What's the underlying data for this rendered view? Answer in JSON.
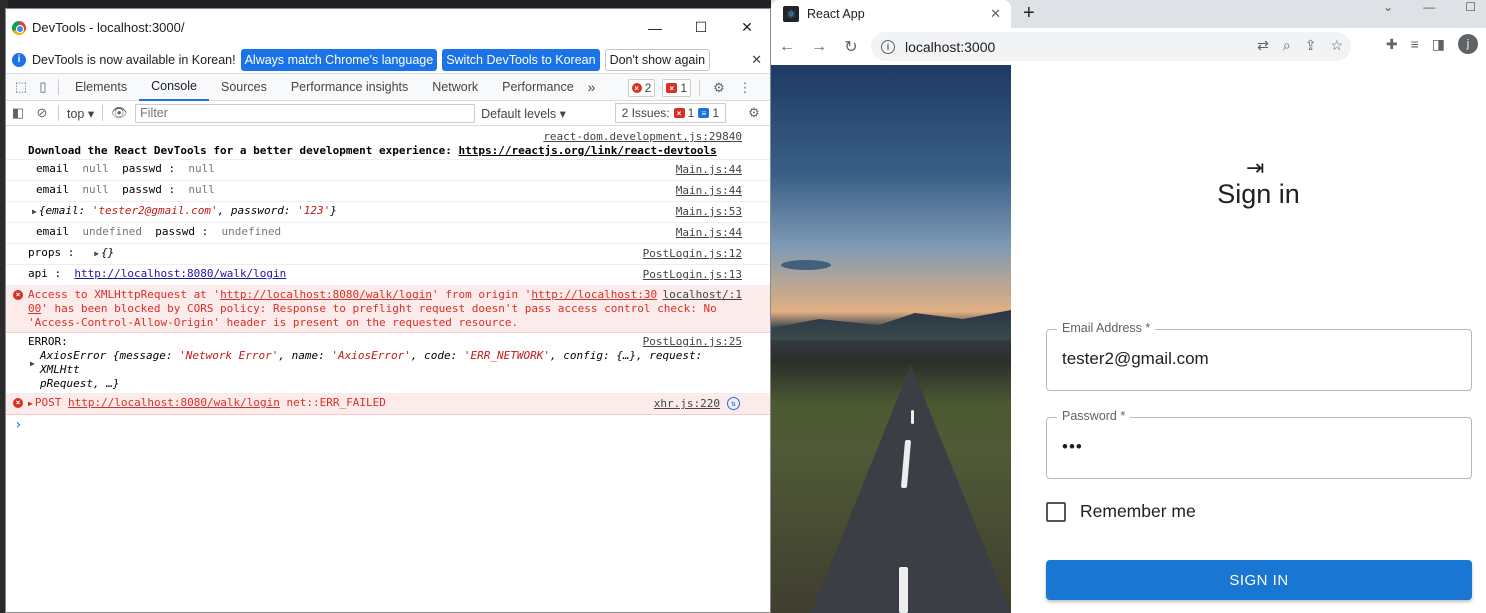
{
  "devtools": {
    "window_title": "DevTools - localhost:3000/",
    "info_bar": {
      "message": "DevTools is now available in Korean!",
      "btn_match": "Always match Chrome's language",
      "btn_switch": "Switch DevTools to Korean",
      "btn_dismiss": "Don't show again"
    },
    "tabs": [
      "Elements",
      "Console",
      "Sources",
      "Performance insights",
      "Network",
      "Performance"
    ],
    "more": "»",
    "error_count": "2",
    "issue_badge_count": "1",
    "filter_bar": {
      "context": "top",
      "placeholder": "Filter",
      "levels": "Default levels",
      "issues_label": "2 Issues:",
      "issues_err": "1",
      "issues_info": "1"
    },
    "console": {
      "r1_src": "react-dom.development.js:29840",
      "r1_text": "Download the React DevTools for a better development experience: ",
      "r1_link": "https://reactjs.org/link/react-devtools",
      "r2_a": "email",
      "r2_b": "null",
      "r2_c": "passwd :",
      "r2_d": "null",
      "r2_src": "Main.js:44",
      "r3_a": "email",
      "r3_b": "null",
      "r3_c": "passwd :",
      "r3_d": "null",
      "r3_src": "Main.js:44",
      "r4_a": "{email: ",
      "r4_b": "'tester2@gmail.com'",
      "r4_c": ", password: ",
      "r4_d": "'123'",
      "r4_e": "}",
      "r4_src": "Main.js:53",
      "r5_a": "email",
      "r5_b": "undefined",
      "r5_c": "passwd :",
      "r5_d": "undefined",
      "r5_src": "Main.js:44",
      "r6_a": "props :",
      "r6_b": "{}",
      "r6_src": "PostLogin.js:12",
      "r7_a": "api :",
      "r7_b": "http://localhost:8080/walk/login",
      "r7_src": "PostLogin.js:13",
      "r8_l1a": "Access to XMLHttpRequest at '",
      "r8_l1b": "http://localhost:8080/walk/login",
      "r8_l1c": "' from origin '",
      "r8_l1d": "http://localhost:30",
      "r8_src": "localhost/:1",
      "r8_l2a": "00",
      "r8_l2b": "' has been blocked by CORS policy: Response to preflight request doesn't pass access control check: No",
      "r8_l3": "'Access-Control-Allow-Origin' header is present on the requested resource.",
      "r9_a": "ERROR:",
      "r9_src": "PostLogin.js:25",
      "r9_l2a": "AxiosError {message: ",
      "r9_l2b": "'Network Error'",
      "r9_l2c": ", name: ",
      "r9_l2d": "'AxiosError'",
      "r9_l2e": ", code: ",
      "r9_l2f": "'ERR_NETWORK'",
      "r9_l2g": ", config: {…}, request: XMLHtt",
      "r9_l3": "pRequest, …}",
      "r10_a": "POST ",
      "r10_b": "http://localhost:8080/walk/login",
      "r10_c": " net::ERR_FAILED",
      "r10_src": "xhr.js:220",
      "prompt": "›"
    }
  },
  "browser": {
    "tab_title": "React App",
    "url": "localhost:3000",
    "avatar_letter": "j"
  },
  "login": {
    "title": "Sign in",
    "email_label": "Email Address *",
    "email_value": "tester2@gmail.com",
    "password_label": "Password *",
    "password_value": "•••",
    "remember": "Remember me",
    "submit": "SIGN IN"
  },
  "colors": {
    "accent": "#1976d2",
    "error": "#d93025",
    "devtools_blue": "#1a73e8"
  }
}
